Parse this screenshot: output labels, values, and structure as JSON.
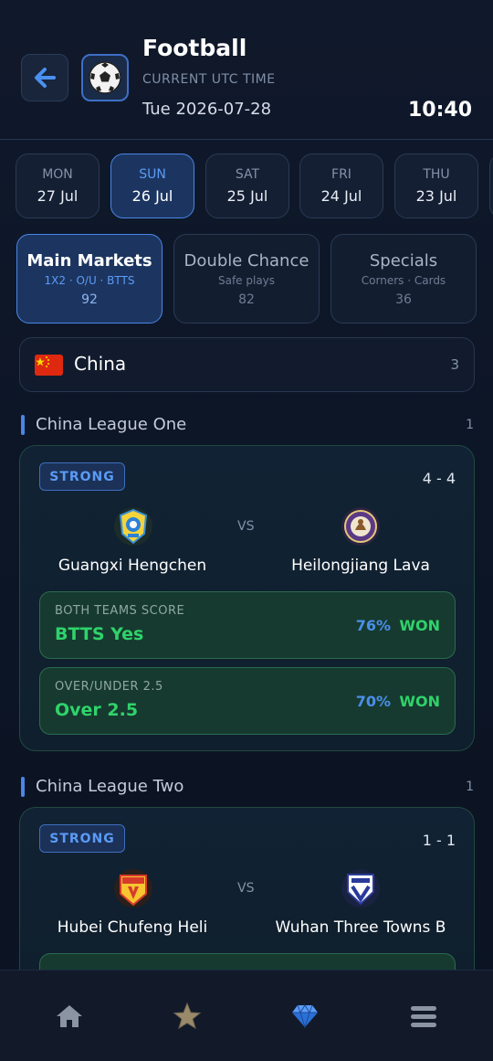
{
  "header": {
    "title": "Football",
    "utc_label": "CURRENT UTC TIME",
    "date": "Tue 2026-07-28",
    "time": "10:40",
    "back_icon": "arrow-left-icon",
    "sport_icon": "soccer-ball-icon"
  },
  "days": [
    {
      "name": "MON",
      "date": "27 Jul",
      "active": false
    },
    {
      "name": "SUN",
      "date": "26 Jul",
      "active": true
    },
    {
      "name": "SAT",
      "date": "25 Jul",
      "active": false
    },
    {
      "name": "FRI",
      "date": "24 Jul",
      "active": false
    },
    {
      "name": "THU",
      "date": "23 Jul",
      "active": false
    }
  ],
  "markets": [
    {
      "label": "Main Markets",
      "sub": "1X2 · O/U · BTTS",
      "count": "92",
      "active": true
    },
    {
      "label": "Double Chance",
      "sub": "Safe plays",
      "count": "82",
      "active": false
    },
    {
      "label": "Specials",
      "sub": "Corners · Cards",
      "count": "36",
      "active": false
    }
  ],
  "country": {
    "name": "China",
    "count": "3",
    "flag_icon": "china-flag-icon"
  },
  "leagues": [
    {
      "name": "China League One",
      "count": "1",
      "match": {
        "badge": "STRONG",
        "score": "4 - 4",
        "home": "Guangxi Hengchen",
        "away": "Heilongjiang Lava",
        "vs": "VS",
        "picks": [
          {
            "label": "BOTH TEAMS SCORE",
            "value": "BTTS Yes",
            "prob": "76%",
            "result": "WON"
          },
          {
            "label": "OVER/UNDER 2.5",
            "value": "Over 2.5",
            "prob": "70%",
            "result": "WON"
          }
        ]
      }
    },
    {
      "name": "China League Two",
      "count": "1",
      "match": {
        "badge": "STRONG",
        "score": "1 - 1",
        "home": "Hubei Chufeng Heli",
        "away": "Wuhan Three Towns B",
        "vs": "VS"
      }
    }
  ],
  "nav": [
    {
      "icon": "home-icon",
      "active": false
    },
    {
      "icon": "star-icon",
      "active": false
    },
    {
      "icon": "diamond-icon",
      "active": true
    },
    {
      "icon": "menu-icon",
      "active": false
    }
  ],
  "colors": {
    "accent": "#4a86e8",
    "won": "#2fd36a",
    "background": "#0d1627"
  }
}
